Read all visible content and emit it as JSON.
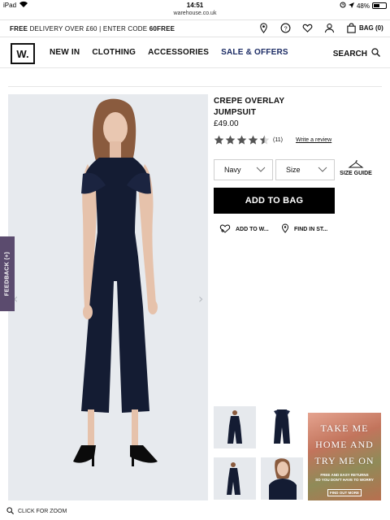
{
  "statusbar": {
    "carrier": "iPad",
    "time": "14:51",
    "battery": "48%",
    "battery_level": 0.48
  },
  "browser": {
    "url": "warehouse.co.uk"
  },
  "promo": {
    "free": "FREE",
    "text1": " DELIVERY OVER £60 | ENTER CODE ",
    "code": "60FREE",
    "bag_label": "BAG (0)"
  },
  "nav": {
    "logo": "W.",
    "items": [
      "NEW IN",
      "CLOTHING",
      "ACCESSORIES",
      "SALE & OFFERS"
    ],
    "search_label": "SEARCH",
    "sale_color": "#1a2a63"
  },
  "product": {
    "title_line1": "CREPE OVERLAY",
    "title_line2": "JUMPSUIT",
    "price": "£49.00",
    "rating": 4.5,
    "rating_max": 5,
    "review_count": "(11)",
    "write_review": "Write a review",
    "colour_selected": "Navy",
    "size_selected": "Size",
    "size_guide": "SIZE GUIDE",
    "add_to_bag": "ADD TO BAG",
    "add_to_wishlist": "ADD TO W...",
    "find_in_store": "FIND IN ST..."
  },
  "feedback": {
    "label": "FEEDBACK (+)",
    "color": "#5b4b6e"
  },
  "gallery": {
    "zoom_label": "CLICK FOR ZOOM",
    "thumbnails": [
      "thumbnail-front",
      "thumbnail-back",
      "thumbnail-side",
      "thumbnail-closeup"
    ]
  },
  "ad": {
    "line1": "TAKE    ME",
    "line2": "HOME AND",
    "line3": "TRY ME ON",
    "small1": "FREE AND EASY RETURNS",
    "small2": "SO YOU DON'T HAVE TO WORRY",
    "button": "FIND OUT MORE"
  },
  "colors": {
    "accent": "#000000",
    "garment": "#141c33",
    "image_bg": "#e7eaee"
  }
}
